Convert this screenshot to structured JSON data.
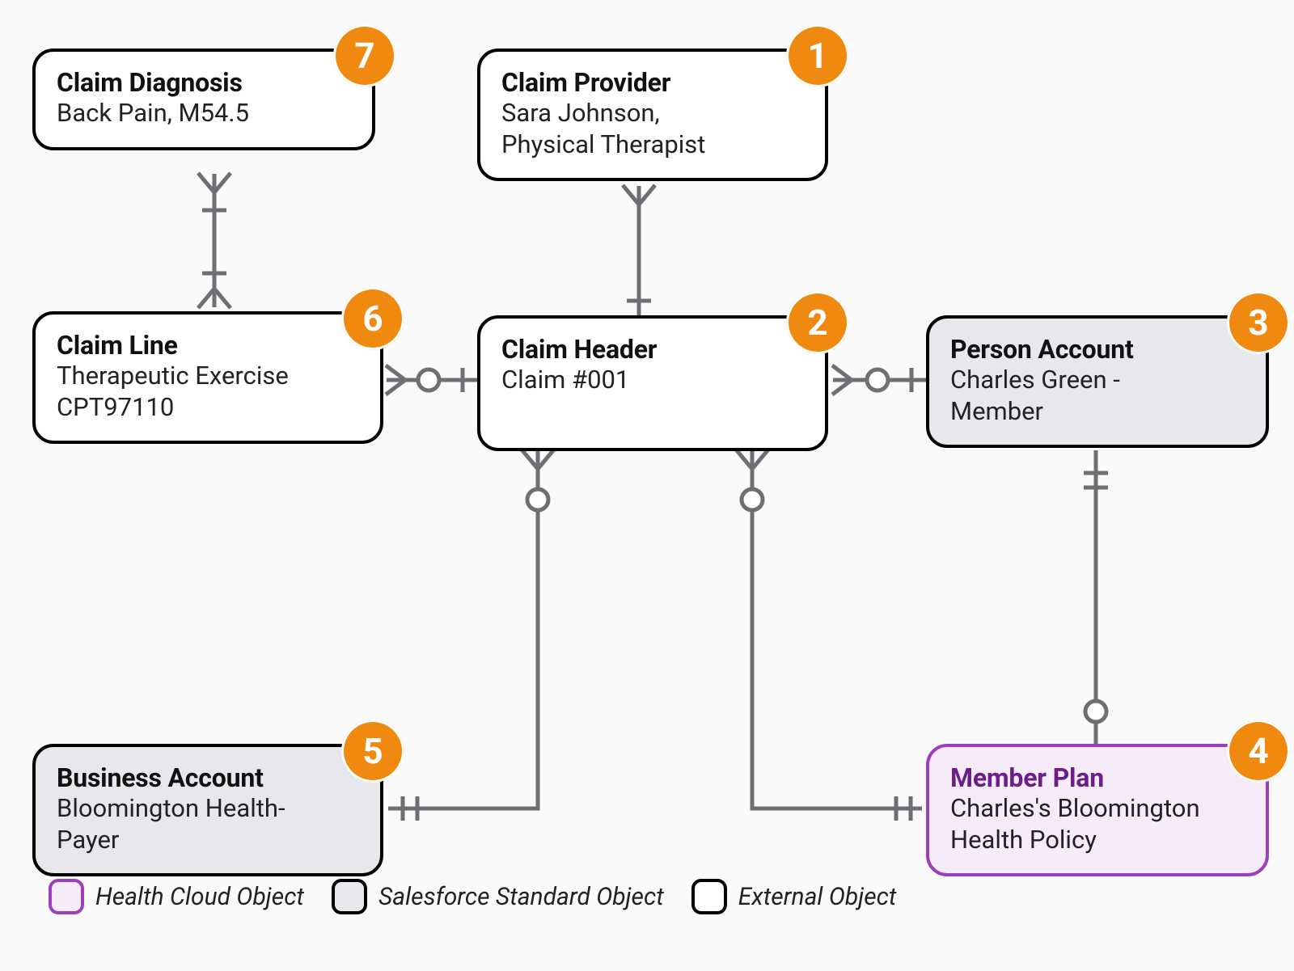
{
  "boxes": {
    "claim_diagnosis": {
      "badge": "7",
      "title": "Claim Diagnosis",
      "detail": "Back Pain, M54.5"
    },
    "claim_provider": {
      "badge": "1",
      "title": "Claim Provider",
      "detail": "Sara Johnson,\nPhysical Therapist"
    },
    "claim_line": {
      "badge": "6",
      "title": "Claim Line",
      "detail": "Therapeutic Exercise\nCPT97110"
    },
    "claim_header": {
      "badge": "2",
      "title": "Claim Header",
      "detail": "Claim #001"
    },
    "person_account": {
      "badge": "3",
      "title": "Person Account",
      "detail": "Charles Green -\nMember"
    },
    "business_account": {
      "badge": "5",
      "title": "Business Account",
      "detail": "Bloomington Health-\nPayer"
    },
    "member_plan": {
      "badge": "4",
      "title": "Member Plan",
      "detail": "Charles's Bloomington\nHealth Policy"
    }
  },
  "legend": {
    "health": "Health Cloud Object",
    "standard": "Salesforce Standard Object",
    "external": "External Object"
  }
}
